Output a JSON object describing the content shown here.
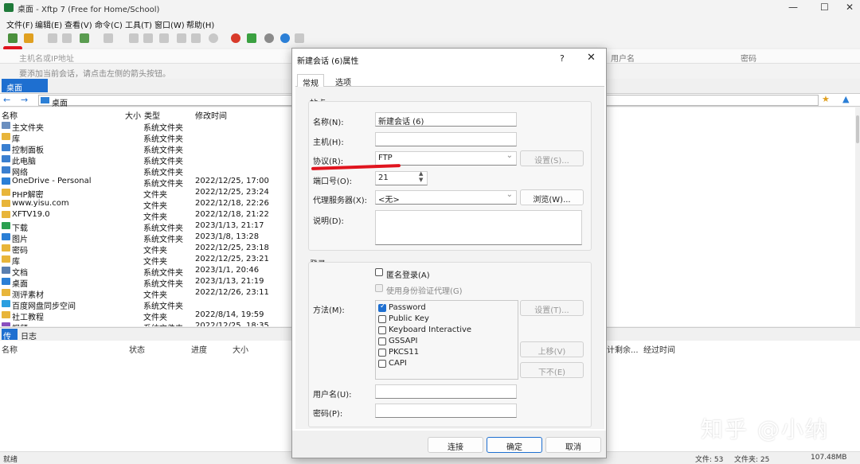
{
  "window": {
    "title": "桌面 - Xftp 7 (Free for Home/School)",
    "min": "—",
    "max": "☐",
    "close": "✕"
  },
  "menu": [
    "文件(F)",
    "编辑(E)",
    "查看(V)",
    "命令(C)",
    "工具(T)",
    "窗口(W)",
    "帮助(H)"
  ],
  "address": {
    "placeholder": "主机名或IP地址",
    "user_label": "用户名",
    "pass_label": "密码"
  },
  "hint": "要添加当前会话，请点击左侧的箭头按钮。",
  "tab": "桌面",
  "path": "桌面",
  "filelist": {
    "headers": {
      "name": "名称",
      "size": "大小",
      "type": "类型",
      "mtime": "修改时间"
    },
    "rows": [
      {
        "name": "主文件夹",
        "type": "系统文件夹",
        "date": "",
        "icon": "home-icon"
      },
      {
        "name": "库",
        "type": "系统文件夹",
        "date": "",
        "icon": "folder-icon"
      },
      {
        "name": "控制面板",
        "type": "系统文件夹",
        "date": "",
        "icon": "control-panel-icon"
      },
      {
        "name": "此电脑",
        "type": "系统文件夹",
        "date": "",
        "icon": "computer-icon"
      },
      {
        "name": "网络",
        "type": "系统文件夹",
        "date": "",
        "icon": "network-icon"
      },
      {
        "name": "OneDrive - Personal",
        "type": "系统文件夹",
        "date": "2022/12/25, 17:00",
        "icon": "cloud-icon"
      },
      {
        "name": "PHP解密",
        "type": "文件夹",
        "date": "2022/12/25, 23:24",
        "icon": "folder-icon"
      },
      {
        "name": "www.yisu.com",
        "type": "文件夹",
        "date": "2022/12/18, 22:26",
        "icon": "folder-icon"
      },
      {
        "name": "XFTV19.0",
        "type": "文件夹",
        "date": "2022/12/18, 21:22",
        "icon": "folder-icon"
      },
      {
        "name": "下载",
        "type": "系统文件夹",
        "date": "2023/1/13, 21:17",
        "icon": "download-icon"
      },
      {
        "name": "图片",
        "type": "系统文件夹",
        "date": "2023/1/8, 13:28",
        "icon": "picture-icon"
      },
      {
        "name": "密码",
        "type": "文件夹",
        "date": "2022/12/25, 23:18",
        "icon": "folder-icon"
      },
      {
        "name": "库",
        "type": "文件夹",
        "date": "2022/12/25, 23:21",
        "icon": "folder-icon"
      },
      {
        "name": "文档",
        "type": "系统文件夹",
        "date": "2023/1/1, 20:46",
        "icon": "document-icon"
      },
      {
        "name": "桌面",
        "type": "系统文件夹",
        "date": "2023/1/13, 21:19",
        "icon": "desktop-icon"
      },
      {
        "name": "测评素材",
        "type": "文件夹",
        "date": "2022/12/26, 23:11",
        "icon": "folder-icon"
      },
      {
        "name": "百度网盘同步空间",
        "type": "系统文件夹",
        "date": "",
        "icon": "sync-icon"
      },
      {
        "name": "社工教程",
        "type": "文件夹",
        "date": "2022/8/14, 19:59",
        "icon": "folder-icon"
      },
      {
        "name": "视频",
        "type": "系统文件夹",
        "date": "2022/12/25, 18:35",
        "icon": "video-icon"
      }
    ]
  },
  "bottom_tabs": {
    "transfer": "传输",
    "log": "日志"
  },
  "transfer_headers": {
    "name": "名称",
    "status": "状态",
    "progress": "进度",
    "size": "大小",
    "remaining": "计剩余...",
    "elapsed": "经过时间"
  },
  "status": {
    "left": "就绪",
    "files": "文件: 53",
    "folders": "文件夹: 25",
    "size": "107.48MB"
  },
  "watermark": "知乎 @小纳",
  "dialog": {
    "title": "新建会话 (6)属性",
    "help": "?",
    "close": "✕",
    "tabs": [
      "常规",
      "选项"
    ],
    "site_group": "站点",
    "name_label": "名称(N):",
    "name_value": "新建会话 (6)",
    "host_label": "主机(H):",
    "host_value": "",
    "protocol_label": "协议(R):",
    "protocol_value": "FTP",
    "settings_btn": "设置(S)...",
    "port_label": "端口号(O):",
    "port_value": "21",
    "proxy_label": "代理服务器(X):",
    "proxy_value": "<无>",
    "browse_btn": "浏览(W)...",
    "desc_label": "说明(D):",
    "login_group": "登录",
    "anon_login": "匿名登录(A)",
    "agent_login": "使用身份验证代理(G)",
    "method_label": "方法(M):",
    "methods": [
      {
        "label": "Password",
        "checked": true
      },
      {
        "label": "Public Key",
        "checked": false
      },
      {
        "label": "Keyboard Interactive",
        "checked": false
      },
      {
        "label": "GSSAPI",
        "checked": false
      },
      {
        "label": "PKCS11",
        "checked": false
      },
      {
        "label": "CAPI",
        "checked": false
      }
    ],
    "method_settings_btn": "设置(T)...",
    "up_btn": "上移(V)",
    "down_btn": "下不(E)",
    "user_label": "用户名(U):",
    "pass_label": "密码(P):",
    "connect_btn": "连接",
    "ok_btn": "确定",
    "cancel_btn": "取消"
  },
  "colors": {
    "accent": "#1e6fd0",
    "redmark": "#e0141e"
  }
}
